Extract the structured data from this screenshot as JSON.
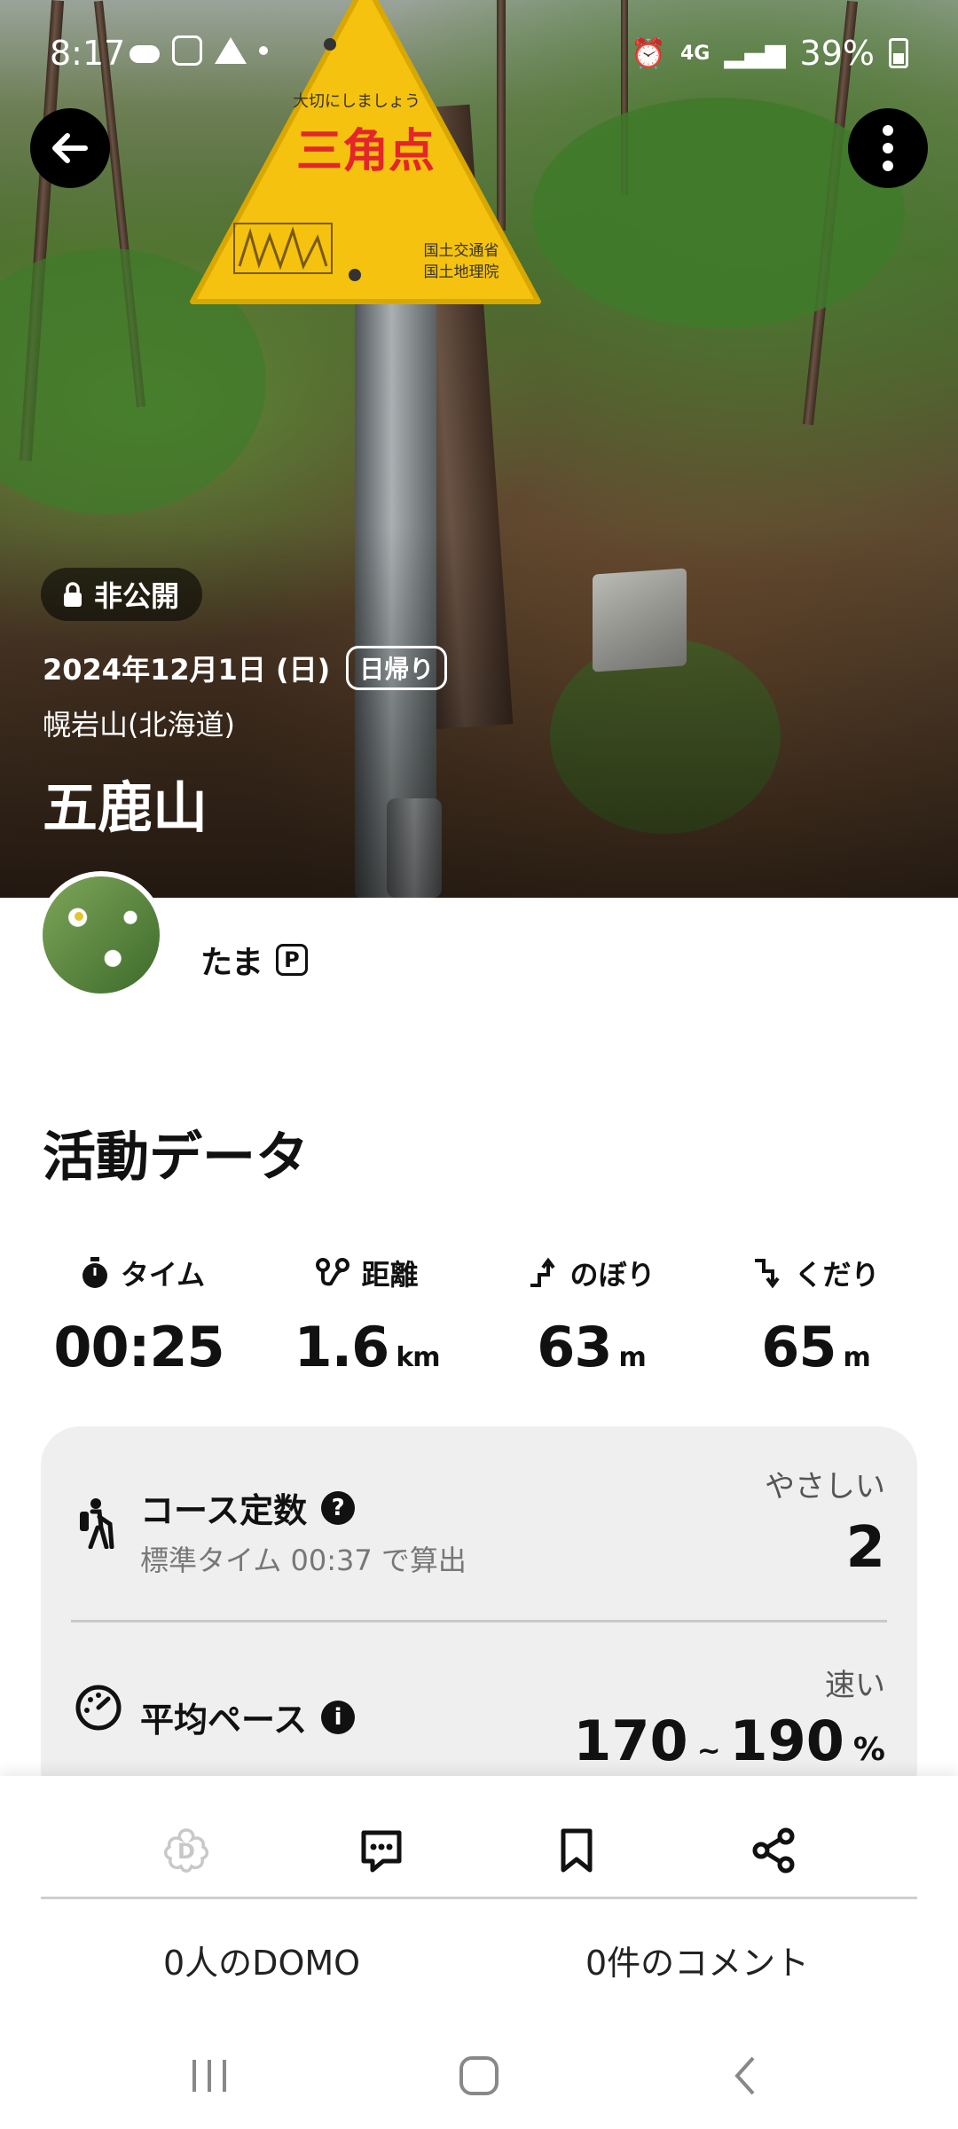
{
  "status_bar": {
    "time": "8:17",
    "network": "4G",
    "battery": "39%"
  },
  "hero": {
    "privacy_label": "非公開",
    "date": "2024年12月1日 (日)",
    "trip_type": "日帰り",
    "area": "幌岩山(北海道)",
    "mountain_name": "五鹿山",
    "sign": {
      "top_text": "大切にしましょう",
      "main_text": "三角点",
      "org1": "国土交通省",
      "org2": "国土地理院"
    }
  },
  "user": {
    "name": "たま",
    "badge": "P"
  },
  "activity": {
    "title": "活動データ",
    "stats": [
      {
        "label": "タイム",
        "value": "00:25",
        "unit": ""
      },
      {
        "label": "距離",
        "value": "1.6",
        "unit": "km"
      },
      {
        "label": "のぼり",
        "value": "63",
        "unit": "m"
      },
      {
        "label": "くだり",
        "value": "65",
        "unit": "m"
      }
    ],
    "course": {
      "title": "コース定数",
      "subtitle": "標準タイム 00:37 で算出",
      "difficulty": "やさしい",
      "value": "2"
    },
    "pace": {
      "title": "平均ペース",
      "speed": "速い",
      "min": "170",
      "sep": "~",
      "max": "190",
      "unit": "%"
    }
  },
  "bottom": {
    "domo_count": "0人のDOMO",
    "comment_count": "0件のコメント"
  },
  "colors": {
    "sign_yellow": "#f4c20f",
    "sign_red": "#e3262a",
    "card_bg": "#efefef"
  }
}
